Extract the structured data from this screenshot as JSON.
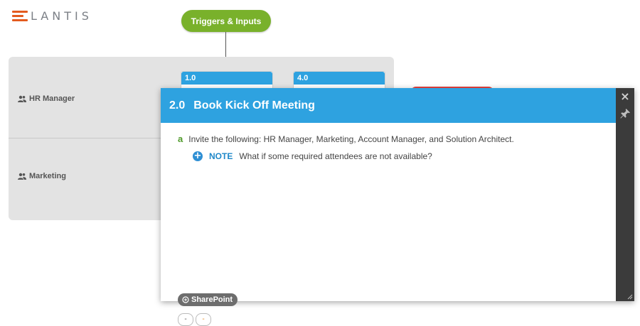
{
  "logo": {
    "text": "LANTIS"
  },
  "trigger": {
    "label": "Triggers & Inputs"
  },
  "lanes": [
    {
      "label": "HR Manager"
    },
    {
      "label": "Marketing"
    }
  ],
  "steps": [
    {
      "number": "1.0"
    },
    {
      "number": "4.0"
    }
  ],
  "panel": {
    "number": "2.0",
    "title": "Book Kick Off Meeting",
    "close_icon": "×",
    "item": {
      "marker": "a",
      "text": "Invite the following: HR Manager, Marketing, Account Manager, and Solution Architect."
    },
    "note": {
      "icon": "+",
      "label": "NOTE",
      "text": "What if some required attendees are not available?"
    },
    "badge": {
      "label": "SharePoint"
    },
    "buttons": [
      {
        "label": "-"
      },
      {
        "label": "-"
      }
    ]
  },
  "colors": {
    "accent_blue": "#2ea2e0",
    "trigger_green": "#79b12b",
    "logo_orange": "#e35b1f",
    "marker_green": "#4f9a2a",
    "note_blue": "#1f88c9"
  },
  "icons": [
    "user-group-icon",
    "close-icon",
    "pin-icon",
    "plus-circle-icon",
    "sharepoint-icon",
    "resize-grip-icon"
  ]
}
